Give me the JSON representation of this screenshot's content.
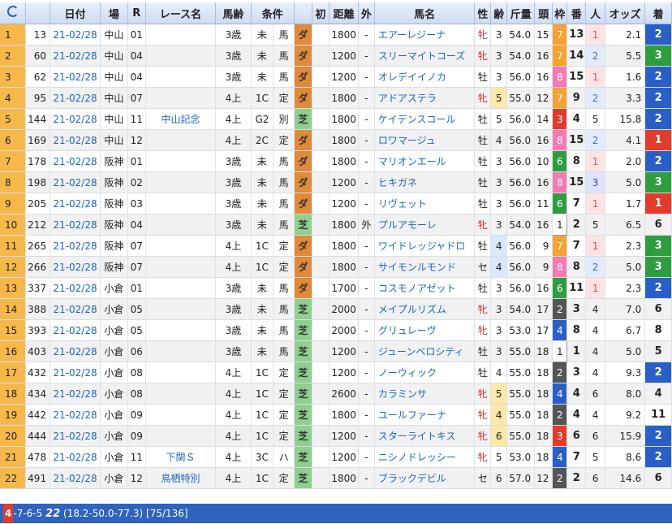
{
  "header": {
    "refresh_icon": "refresh-icon",
    "columns": [
      "日付",
      "場",
      "R",
      "レース名",
      "馬齢",
      "条件",
      "初",
      "距離",
      "外",
      "馬名",
      "性",
      "齢",
      "斤量",
      "頭",
      "枠",
      "番",
      "人",
      "オッズ",
      "着"
    ]
  },
  "rows": [
    {
      "no": "1",
      "id": "13",
      "date": "21-02/28",
      "place": "中山",
      "r": "01",
      "race": "",
      "age": "3歳",
      "cond": "未",
      "rest": "馬",
      "track": "ダ",
      "first": "",
      "dist": "1800",
      "out": "-",
      "horse": "エアーレジーナ",
      "sex": "牝",
      "hage": "3",
      "kin": "54.0",
      "heads": "15",
      "waku": "7",
      "ban": "13",
      "ninki": "1",
      "odds": "2.1",
      "fin": "2"
    },
    {
      "no": "2",
      "id": "60",
      "date": "21-02/28",
      "place": "中山",
      "r": "04",
      "race": "",
      "age": "3歳",
      "cond": "未",
      "rest": "馬",
      "track": "ダ",
      "first": "",
      "dist": "1200",
      "out": "-",
      "horse": "スリーマイトコーズ",
      "sex": "牝",
      "hage": "3",
      "kin": "54.0",
      "heads": "16",
      "waku": "7",
      "ban": "14",
      "ninki": "2",
      "odds": "5.5",
      "fin": "3"
    },
    {
      "no": "3",
      "id": "62",
      "date": "21-02/28",
      "place": "中山",
      "r": "04",
      "race": "",
      "age": "3歳",
      "cond": "未",
      "rest": "馬",
      "track": "ダ",
      "first": "",
      "dist": "1200",
      "out": "-",
      "horse": "オレデイイノカ",
      "sex": "牡",
      "hage": "3",
      "kin": "56.0",
      "heads": "16",
      "waku": "8",
      "ban": "15",
      "ninki": "1",
      "odds": "1.6",
      "fin": "2"
    },
    {
      "no": "4",
      "id": "95",
      "date": "21-02/28",
      "place": "中山",
      "r": "07",
      "race": "",
      "age": "4上",
      "cond": "1C",
      "rest": "定",
      "track": "ダ",
      "first": "",
      "dist": "1800",
      "out": "-",
      "horse": "アドアステラ",
      "sex": "牝",
      "hage": "5",
      "kin": "55.0",
      "heads": "12",
      "waku": "7",
      "ban": "9",
      "ninki": "2",
      "odds": "3.3",
      "fin": "2"
    },
    {
      "no": "5",
      "id": "144",
      "date": "21-02/28",
      "place": "中山",
      "r": "11",
      "race": "中山記念",
      "age": "4上",
      "cond": "G2",
      "rest": "別",
      "track": "芝",
      "first": "",
      "dist": "1800",
      "out": "-",
      "horse": "ケイデンスコール",
      "sex": "牡",
      "hage": "5",
      "kin": "56.0",
      "heads": "14",
      "waku": "3",
      "ban": "4",
      "ninki": "5",
      "odds": "15.8",
      "fin": "2"
    },
    {
      "no": "6",
      "id": "169",
      "date": "21-02/28",
      "place": "中山",
      "r": "12",
      "race": "",
      "age": "4上",
      "cond": "2C",
      "rest": "定",
      "track": "ダ",
      "first": "",
      "dist": "1800",
      "out": "-",
      "horse": "ロワマージュ",
      "sex": "牡",
      "hage": "4",
      "kin": "56.0",
      "heads": "16",
      "waku": "8",
      "ban": "15",
      "ninki": "2",
      "odds": "4.1",
      "fin": "1"
    },
    {
      "no": "7",
      "id": "178",
      "date": "21-02/28",
      "place": "阪神",
      "r": "01",
      "race": "",
      "age": "3歳",
      "cond": "未",
      "rest": "馬",
      "track": "ダ",
      "first": "",
      "dist": "1800",
      "out": "-",
      "horse": "マリオンエール",
      "sex": "牡",
      "hage": "3",
      "kin": "56.0",
      "heads": "10",
      "waku": "6",
      "ban": "8",
      "ninki": "1",
      "odds": "2.0",
      "fin": "2"
    },
    {
      "no": "8",
      "id": "198",
      "date": "21-02/28",
      "place": "阪神",
      "r": "02",
      "race": "",
      "age": "3歳",
      "cond": "未",
      "rest": "馬",
      "track": "ダ",
      "first": "",
      "dist": "1200",
      "out": "-",
      "horse": "ヒキガネ",
      "sex": "牡",
      "hage": "3",
      "kin": "56.0",
      "heads": "16",
      "waku": "8",
      "ban": "15",
      "ninki": "3",
      "odds": "5.0",
      "fin": "3"
    },
    {
      "no": "9",
      "id": "205",
      "date": "21-02/28",
      "place": "阪神",
      "r": "03",
      "race": "",
      "age": "3歳",
      "cond": "未",
      "rest": "馬",
      "track": "ダ",
      "first": "",
      "dist": "1200",
      "out": "-",
      "horse": "リヴェット",
      "sex": "牡",
      "hage": "3",
      "kin": "56.0",
      "heads": "11",
      "waku": "6",
      "ban": "7",
      "ninki": "1",
      "odds": "1.7",
      "fin": "1"
    },
    {
      "no": "10",
      "id": "212",
      "date": "21-02/28",
      "place": "阪神",
      "r": "04",
      "race": "",
      "age": "3歳",
      "cond": "未",
      "rest": "馬",
      "track": "芝",
      "first": "",
      "dist": "1800",
      "out": "外",
      "horse": "プルアモーレ",
      "sex": "牝",
      "hage": "3",
      "kin": "54.0",
      "heads": "16",
      "waku": "1",
      "ban": "2",
      "ninki": "5",
      "odds": "6.5",
      "fin": "6"
    },
    {
      "no": "11",
      "id": "265",
      "date": "21-02/28",
      "place": "阪神",
      "r": "07",
      "race": "",
      "age": "4上",
      "cond": "1C",
      "rest": "定",
      "track": "ダ",
      "first": "",
      "dist": "1800",
      "out": "-",
      "horse": "ワイドレッジャドロ",
      "sex": "牡",
      "hage": "4",
      "kin": "56.0",
      "heads": "9",
      "waku": "7",
      "ban": "7",
      "ninki": "1",
      "odds": "2.3",
      "fin": "3"
    },
    {
      "no": "12",
      "id": "266",
      "date": "21-02/28",
      "place": "阪神",
      "r": "07",
      "race": "",
      "age": "4上",
      "cond": "1C",
      "rest": "定",
      "track": "ダ",
      "first": "",
      "dist": "1800",
      "out": "-",
      "horse": "サイモンルモンド",
      "sex": "セ",
      "hage": "4",
      "kin": "56.0",
      "heads": "9",
      "waku": "8",
      "ban": "8",
      "ninki": "2",
      "odds": "5.0",
      "fin": "3"
    },
    {
      "no": "13",
      "id": "337",
      "date": "21-02/28",
      "place": "小倉",
      "r": "01",
      "race": "",
      "age": "3歳",
      "cond": "未",
      "rest": "馬",
      "track": "ダ",
      "first": "",
      "dist": "1700",
      "out": "-",
      "horse": "コスモノアゼット",
      "sex": "牡",
      "hage": "3",
      "kin": "56.0",
      "heads": "16",
      "waku": "6",
      "ban": "11",
      "ninki": "1",
      "odds": "2.3",
      "fin": "2"
    },
    {
      "no": "14",
      "id": "388",
      "date": "21-02/28",
      "place": "小倉",
      "r": "05",
      "race": "",
      "age": "3歳",
      "cond": "未",
      "rest": "馬",
      "track": "芝",
      "first": "",
      "dist": "2000",
      "out": "-",
      "horse": "メイプルリズム",
      "sex": "牝",
      "hage": "3",
      "kin": "54.0",
      "heads": "17",
      "waku": "2",
      "ban": "3",
      "ninki": "4",
      "odds": "7.0",
      "fin": "6"
    },
    {
      "no": "15",
      "id": "393",
      "date": "21-02/28",
      "place": "小倉",
      "r": "05",
      "race": "",
      "age": "3歳",
      "cond": "未",
      "rest": "馬",
      "track": "芝",
      "first": "",
      "dist": "2000",
      "out": "-",
      "horse": "グリュレーヴ",
      "sex": "牝",
      "hage": "3",
      "kin": "53.0",
      "heads": "17",
      "waku": "4",
      "ban": "8",
      "ninki": "4",
      "odds": "6.7",
      "fin": "8"
    },
    {
      "no": "16",
      "id": "403",
      "date": "21-02/28",
      "place": "小倉",
      "r": "06",
      "race": "",
      "age": "3歳",
      "cond": "未",
      "rest": "馬",
      "track": "芝",
      "first": "",
      "dist": "1200",
      "out": "-",
      "horse": "ジューンベロシティ",
      "sex": "牡",
      "hage": "3",
      "kin": "55.0",
      "heads": "18",
      "waku": "1",
      "ban": "1",
      "ninki": "4",
      "odds": "5.0",
      "fin": "5"
    },
    {
      "no": "17",
      "id": "432",
      "date": "21-02/28",
      "place": "小倉",
      "r": "08",
      "race": "",
      "age": "4上",
      "cond": "1C",
      "rest": "定",
      "track": "芝",
      "first": "",
      "dist": "1200",
      "out": "-",
      "horse": "ノーウィック",
      "sex": "牡",
      "hage": "4",
      "kin": "55.0",
      "heads": "18",
      "waku": "2",
      "ban": "3",
      "ninki": "4",
      "odds": "9.3",
      "fin": "2"
    },
    {
      "no": "18",
      "id": "434",
      "date": "21-02/28",
      "place": "小倉",
      "r": "08",
      "race": "",
      "age": "4上",
      "cond": "1C",
      "rest": "定",
      "track": "芝",
      "first": "",
      "dist": "2600",
      "out": "-",
      "horse": "カラミンサ",
      "sex": "牝",
      "hage": "5",
      "kin": "55.0",
      "heads": "18",
      "waku": "4",
      "ban": "4",
      "ninki": "6",
      "odds": "8.0",
      "fin": "4"
    },
    {
      "no": "19",
      "id": "442",
      "date": "21-02/28",
      "place": "小倉",
      "r": "09",
      "race": "",
      "age": "4上",
      "cond": "1C",
      "rest": "定",
      "track": "芝",
      "first": "",
      "dist": "1800",
      "out": "-",
      "horse": "ユールファーナ",
      "sex": "牝",
      "hage": "4",
      "kin": "55.0",
      "heads": "18",
      "waku": "2",
      "ban": "4",
      "ninki": "4",
      "odds": "9.2",
      "fin": "11"
    },
    {
      "no": "20",
      "id": "444",
      "date": "21-02/28",
      "place": "小倉",
      "r": "09",
      "race": "",
      "age": "4上",
      "cond": "1C",
      "rest": "定",
      "track": "芝",
      "first": "",
      "dist": "1200",
      "out": "-",
      "horse": "スターライトキス",
      "sex": "牝",
      "hage": "6",
      "kin": "55.0",
      "heads": "18",
      "waku": "3",
      "ban": "6",
      "ninki": "6",
      "odds": "15.9",
      "fin": "2"
    },
    {
      "no": "21",
      "id": "478",
      "date": "21-02/28",
      "place": "小倉",
      "r": "11",
      "race": "下関Ｓ",
      "age": "4上",
      "cond": "3C",
      "rest": "ハ",
      "track": "芝",
      "first": "",
      "dist": "1200",
      "out": "-",
      "horse": "ニシノドレッシー",
      "sex": "牝",
      "hage": "5",
      "kin": "53.0",
      "heads": "18",
      "waku": "4",
      "ban": "7",
      "ninki": "5",
      "odds": "8.6",
      "fin": "2"
    },
    {
      "no": "22",
      "id": "491",
      "date": "21-02/28",
      "place": "小倉",
      "r": "12",
      "race": "鳥栖特別",
      "age": "4上",
      "cond": "1C",
      "rest": "定",
      "track": "芝",
      "first": "",
      "dist": "1800",
      "out": "-",
      "horse": "ブラックデビル",
      "sex": "セ",
      "hage": "6",
      "kin": "57.0",
      "heads": "12",
      "waku": "2",
      "ban": "2",
      "ninki": "6",
      "odds": "14.6",
      "fin": "6"
    }
  ],
  "status": {
    "chip": "4",
    "seq": "-7-6-5",
    "big": "22",
    "detail": "(18.2-50.0-77.3) [75/136]"
  }
}
